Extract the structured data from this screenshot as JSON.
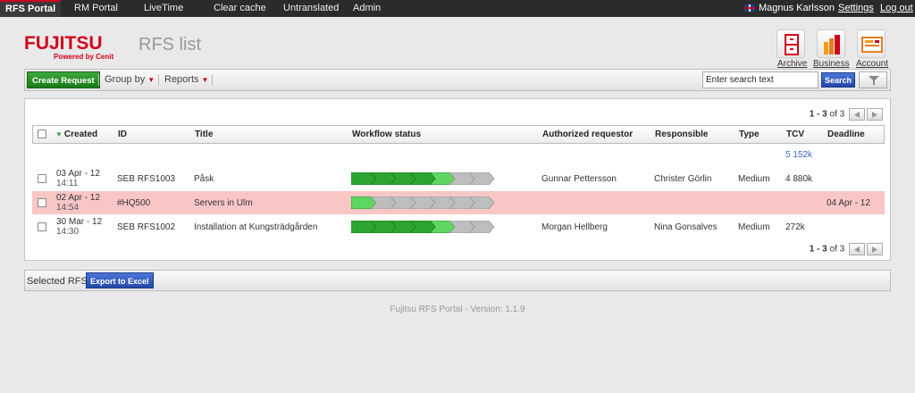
{
  "topnav": {
    "tabs": [
      "RFS Portal",
      "RM Portal",
      "LiveTime",
      "Clear cache",
      "Untranslated",
      "Admin"
    ],
    "user": "Magnus Karlsson",
    "settings": "Settings",
    "logout": "Log out"
  },
  "header": {
    "brand": "FUJITSU",
    "tagline": "Powered by Cenit",
    "title": "RFS list",
    "icons": [
      {
        "label": "Archive",
        "icon": "archive-icon"
      },
      {
        "label": "Business",
        "icon": "business-icon"
      },
      {
        "label": "Account",
        "icon": "account-icon"
      }
    ]
  },
  "toolbar": {
    "create": "Create Request",
    "group_by": "Group by",
    "reports": "Reports",
    "search_value": "Enter search text",
    "search_btn": "Search"
  },
  "table": {
    "pager": {
      "range": "1 - 3",
      "of": "of 3"
    },
    "columns": [
      "Created",
      "ID",
      "Title",
      "Workflow status",
      "Authorized requestor",
      "Responsible",
      "Type",
      "TCV",
      "Deadline"
    ],
    "tcv_total": "5 152k",
    "rows": [
      {
        "date": "03 Apr - 12",
        "time": "14:11",
        "id": "SEB RFS1003",
        "title": "Påsk",
        "workflow_done": 5,
        "workflow_total": 7,
        "requestor": "Gunnar Pettersson",
        "responsible": "Christer Görlin",
        "type": "Medium",
        "tcv": "4 880k",
        "deadline": "",
        "highlight": false
      },
      {
        "date": "02 Apr - 12",
        "time": "14:54",
        "id": "#HQ500",
        "title": "Servers in Ulm",
        "workflow_done": 1,
        "workflow_total": 7,
        "requestor": "",
        "responsible": "",
        "type": "",
        "tcv": "",
        "deadline": "04 Apr - 12",
        "highlight": true
      },
      {
        "date": "30 Mar - 12",
        "time": "14:30",
        "id": "SEB RFS1002",
        "title": "Installation at Kungsträdgården",
        "workflow_done": 5,
        "workflow_total": 7,
        "requestor": "Morgan Hellberg",
        "responsible": "Nina Gonsalves",
        "type": "Medium",
        "tcv": "272k",
        "deadline": "",
        "highlight": false
      }
    ]
  },
  "selbar": {
    "label": "Selected RFS:",
    "export": "Export to Excel"
  },
  "footer": "Fujitsu RFS Portal - Version: 1.1.9",
  "colors": {
    "accent": "#d0021b",
    "done": "#2ea52e",
    "pending": "#bdbdbd",
    "highlight": "#f9c6c6"
  }
}
